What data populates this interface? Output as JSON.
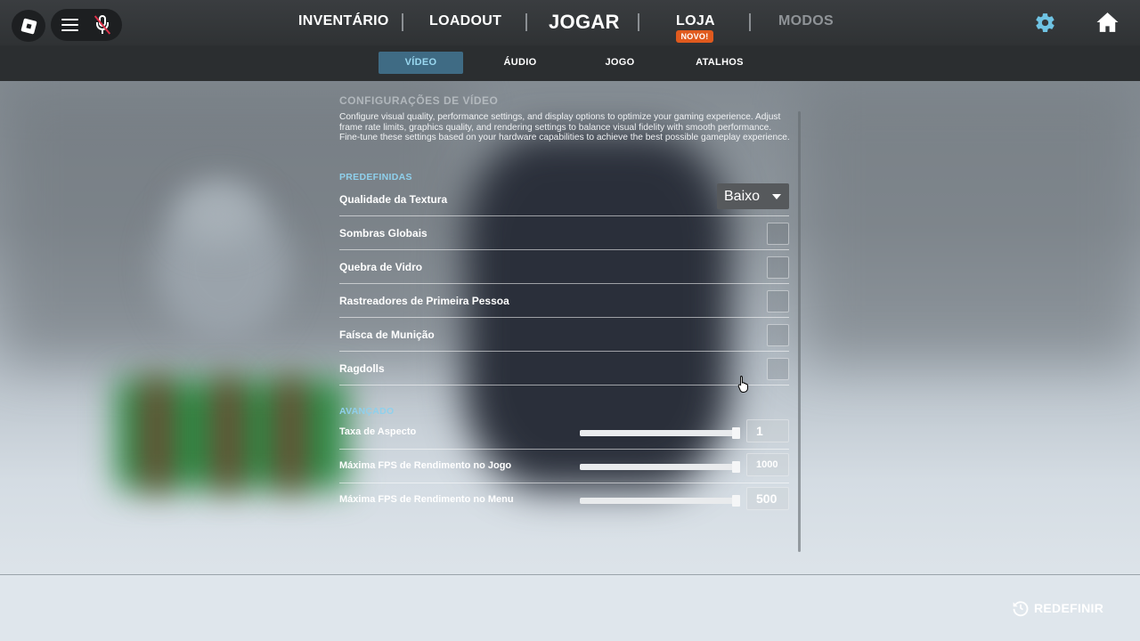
{
  "topbar": {
    "nav": [
      {
        "label": "INVENTÁRIO"
      },
      {
        "label": "LOADOUT"
      },
      {
        "label": "JOGAR"
      },
      {
        "label": "LOJA",
        "badge": "NOVO!"
      },
      {
        "label": "MODOS"
      }
    ],
    "icons": [
      "roblox-logo-icon",
      "menu-icon",
      "mic-muted-icon",
      "gear-icon",
      "home-icon"
    ]
  },
  "tabs": [
    {
      "label": "VÍDEO",
      "active": true
    },
    {
      "label": "ÁUDIO",
      "active": false
    },
    {
      "label": "JOGO",
      "active": false
    },
    {
      "label": "ATALHOS",
      "active": false
    }
  ],
  "panel": {
    "title": "CONFIGURAÇÕES DE VÍDEO",
    "description": "Configure visual quality, performance settings, and display options to optimize your gaming experience. Adjust frame rate limits, graphics quality, and rendering settings to balance visual fidelity with smooth performance. Fine-tune these settings based on your hardware capabilities to achieve the best possible gameplay experience."
  },
  "presets": {
    "heading": "PREDEFINIDAS",
    "texture_quality": {
      "label": "Qualidade da Textura",
      "value": "Baixo"
    },
    "toggles": [
      {
        "label": "Sombras Globais",
        "checked": false
      },
      {
        "label": "Quebra de Vidro",
        "checked": false
      },
      {
        "label": "Rastreadores de Primeira Pessoa",
        "checked": false
      },
      {
        "label": "Faísca de Munição",
        "checked": false
      },
      {
        "label": "Ragdolls",
        "checked": false
      }
    ]
  },
  "advanced": {
    "heading": "AVANÇADO",
    "sliders": [
      {
        "label": "Taxa de Aspecto",
        "value": "1",
        "fraction": 1.0
      },
      {
        "label": "Máxima FPS de Rendimento no Jogo",
        "value": "1000",
        "fraction": 1.0
      },
      {
        "label": "Máxima FPS de Rendimento no Menu",
        "value": "500",
        "fraction": 1.0
      }
    ]
  },
  "footer": {
    "reset_label": "REDEFINIR"
  },
  "colors": {
    "accent": "#8fd0ec",
    "active_tab_bg": "#3f6b84",
    "badge": "#e05a1e"
  }
}
